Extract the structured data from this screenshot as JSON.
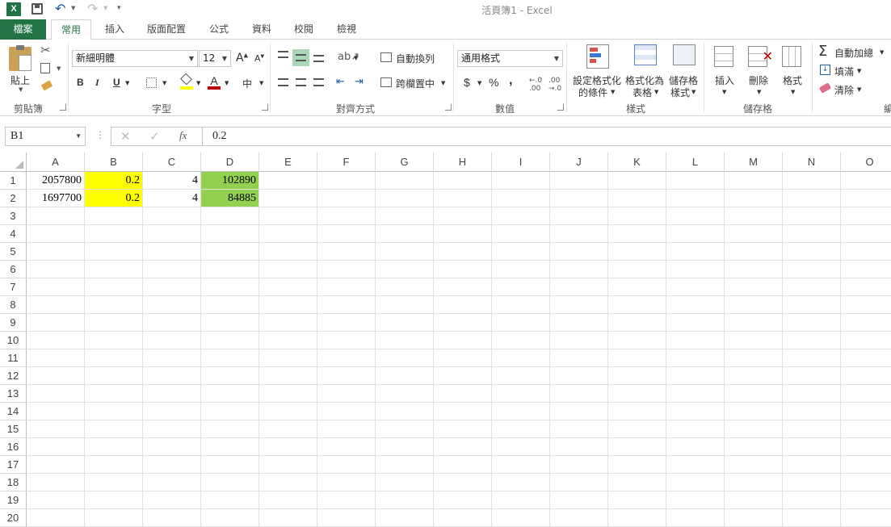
{
  "window": {
    "title": "活頁簿1 - Excel"
  },
  "tabs": [
    {
      "label": "檔案"
    },
    {
      "label": "常用"
    },
    {
      "label": "插入"
    },
    {
      "label": "版面配置"
    },
    {
      "label": "公式"
    },
    {
      "label": "資料"
    },
    {
      "label": "校閱"
    },
    {
      "label": "檢視"
    }
  ],
  "ribbon": {
    "clipboard": {
      "paste": "貼上",
      "label": "剪貼簿"
    },
    "font": {
      "name": "新細明體",
      "size": "12",
      "bold": "B",
      "italic": "I",
      "underline": "U",
      "label": "字型"
    },
    "alignment": {
      "wrap": "自動換列",
      "merge": "跨欄置中",
      "label": "對齊方式"
    },
    "number": {
      "format": "通用格式",
      "currency": "$",
      "percent": "%",
      "comma": ",",
      "label": "數值"
    },
    "styles": {
      "conditional": "設定格式化",
      "conditional2": "的條件",
      "table": "格式化為",
      "table2": "表格",
      "cell": "儲存格",
      "cell2": "樣式",
      "label": "樣式"
    },
    "cells": {
      "insert": "插入",
      "delete": "刪除",
      "format": "格式",
      "label": "儲存格"
    },
    "editing": {
      "autosum": "自動加總",
      "fill": "填滿",
      "clear": "清除",
      "label": "編"
    }
  },
  "formula_bar": {
    "name_box": "B1",
    "fx": "fx",
    "value": "0.2"
  },
  "sheet": {
    "columns": [
      "A",
      "B",
      "C",
      "D",
      "E",
      "F",
      "G",
      "H",
      "I",
      "J",
      "K",
      "L",
      "M",
      "N",
      "O"
    ],
    "rows": [
      "1",
      "2",
      "3",
      "4",
      "5",
      "6",
      "7",
      "8",
      "9",
      "10",
      "11",
      "12",
      "13",
      "14",
      "15",
      "16",
      "17",
      "18",
      "19",
      "20"
    ],
    "cells": {
      "A1": "2057800",
      "B1": "0.2",
      "C1": "4",
      "D1": "102890",
      "A2": "1697700",
      "B2": "0.2",
      "C2": "4",
      "D2": "84885"
    },
    "fills": {
      "B": "#ffff00",
      "D": "#92d050"
    }
  }
}
